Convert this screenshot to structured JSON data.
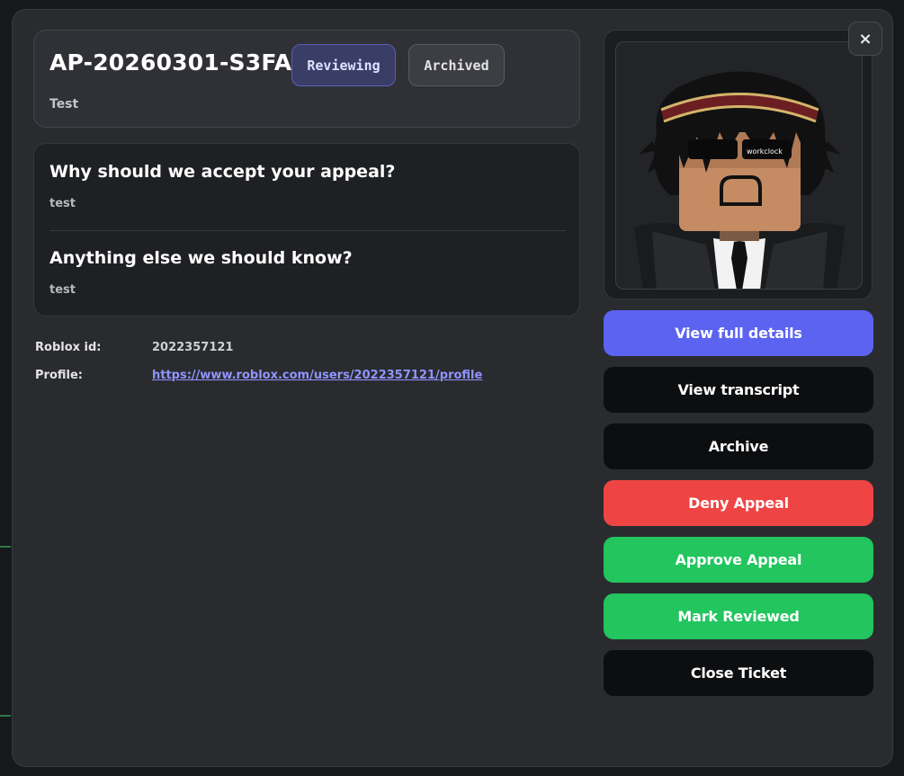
{
  "ticket": {
    "id": "AP-20260301-S3FA",
    "status_badge": "Reviewing",
    "archived_badge": "Archived",
    "subtitle": "Test"
  },
  "questions": [
    {
      "question": "Why should we accept your appeal?",
      "answer": "test"
    },
    {
      "question": "Anything else we should know?",
      "answer": "test"
    }
  ],
  "info": {
    "roblox_id_label": "Roblox id:",
    "roblox_id_value": "2022357121",
    "profile_label": "Profile:",
    "profile_link": "https://www.roblox.com/users/2022357121/profile"
  },
  "avatar": {
    "name_tag": "workclock"
  },
  "actions": {
    "close_icon": "×",
    "view_full_details": "View full details",
    "view_transcript": "View transcript",
    "archive": "Archive",
    "deny_appeal": "Deny Appeal",
    "approve_appeal": "Approve Appeal",
    "mark_reviewed": "Mark Reviewed",
    "close_ticket": "Close Ticket"
  },
  "colors": {
    "accent": "#5b63f0",
    "deny": "#ee4444",
    "approve": "#22c55e",
    "dark_button": "#0d0e10"
  }
}
